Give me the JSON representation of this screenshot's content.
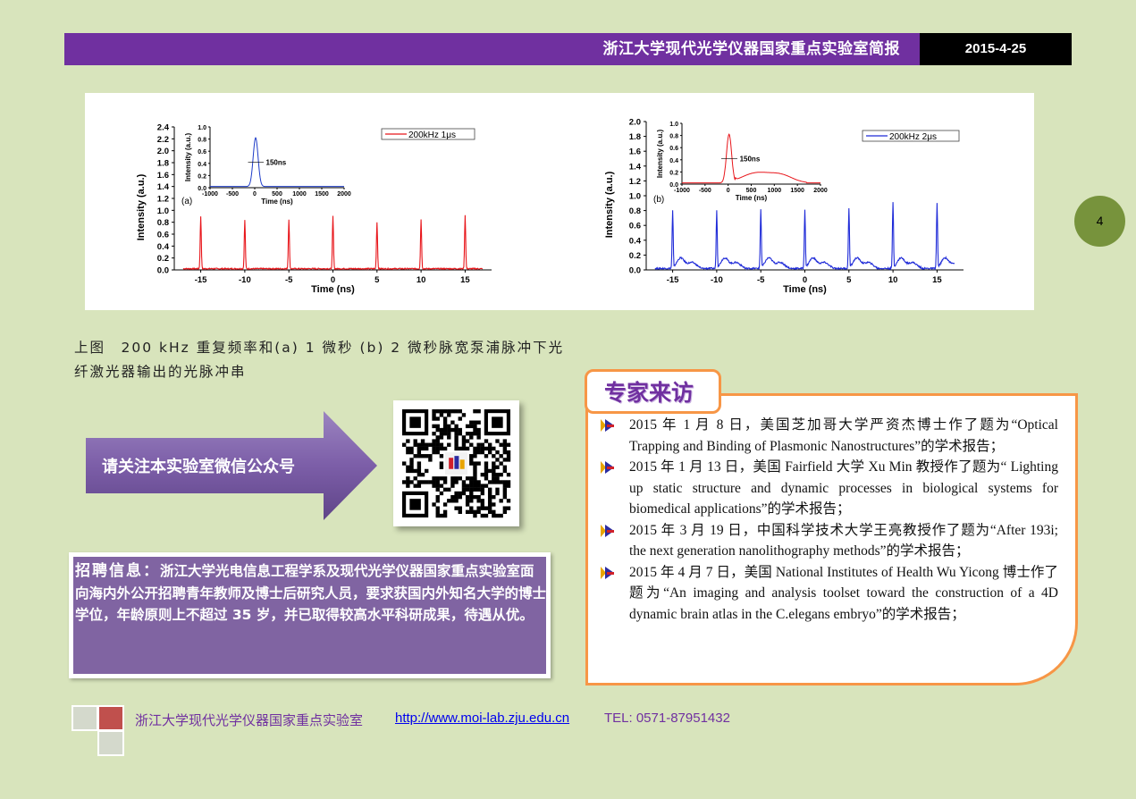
{
  "header": {
    "title": "浙江大学现代光学仪器国家重点实验室简报",
    "date": "2015-4-25"
  },
  "page_number": "4",
  "figure": {
    "chart_data": [
      {
        "type": "line",
        "panel": "(a)",
        "legend": "200kHz 1μs",
        "series_color": "#e8161b",
        "xlabel": "Time (ns)",
        "ylabel": "Intensity (a.u.)",
        "xlim": [
          -18,
          18
        ],
        "ylim": [
          0,
          2.4
        ],
        "x_ticks": [
          "-15",
          "-10",
          "-5",
          "0",
          "5",
          "10",
          "15"
        ],
        "y_ticks": [
          "0.0",
          "0.2",
          "0.4",
          "0.6",
          "0.8",
          "1.0",
          "1.2",
          "1.4",
          "1.6",
          "1.8",
          "2.0",
          "2.2",
          "2.4"
        ],
        "pulse_positions": [
          -15,
          -10,
          -5,
          0,
          5,
          10,
          15
        ],
        "pulse_peaks": [
          0.88,
          0.82,
          0.83,
          0.88,
          0.78,
          0.83,
          0.9
        ],
        "inset": {
          "xlabel": "Time (ns)",
          "ylabel": "Intensity (a.u.)",
          "x_ticks": [
            "-1000",
            "-500",
            "0",
            "500",
            "1000",
            "1500",
            "2000"
          ],
          "y_ticks": [
            "0.0",
            "0.2",
            "0.4",
            "0.6",
            "0.8",
            "1.0"
          ],
          "annotation": "150ns",
          "series_color": "#1f3cc8"
        }
      },
      {
        "type": "line",
        "panel": "(b)",
        "legend": "200kHz 2μs",
        "series_color": "#1f2bd8",
        "xlabel": "Time (ns)",
        "ylabel": "Intensity (a.u.)",
        "xlim": [
          -18,
          18
        ],
        "ylim": [
          0,
          2.0
        ],
        "x_ticks": [
          "-15",
          "-10",
          "-5",
          "0",
          "5",
          "10",
          "15"
        ],
        "y_ticks": [
          "0.0",
          "0.2",
          "0.4",
          "0.6",
          "0.8",
          "1.0",
          "1.2",
          "1.4",
          "1.6",
          "1.8",
          "2.0"
        ],
        "pulse_positions": [
          -15,
          -10,
          -5,
          0,
          5,
          10,
          15
        ],
        "pulse_peaks": [
          0.78,
          0.78,
          0.8,
          0.8,
          0.82,
          0.9,
          0.88
        ],
        "inset": {
          "xlabel": "Time (ns)",
          "ylabel": "Intensity (a.u.)",
          "x_ticks": [
            "-1000",
            "-500",
            "0",
            "500",
            "1000",
            "1500",
            "2000"
          ],
          "y_ticks": [
            "0.0",
            "0.2",
            "0.4",
            "0.6",
            "0.8",
            "1.0"
          ],
          "annotation": "150ns",
          "series_color": "#e8161b"
        }
      }
    ]
  },
  "caption": "上图　200 kHz 重复频率和(a) 1 微秒 (b) 2 微秒脉宽泵浦脉冲下光纤激光器输出的光脉冲串",
  "wechat": {
    "label": "请关注本实验室微信公众号",
    "qr_icon": "qr-code-icon"
  },
  "recruit": {
    "heading": "招聘信息：",
    "body": "浙江大学光电信息工程学系及现代光学仪器国家重点实验室面向海内外公开招聘青年教师及博士后研究人员，要求获国内外知名大学的博士学位，年龄原则上不超过 35 岁，并已取得较高水平科研成果，待遇从优。"
  },
  "experts": {
    "title": "专家来访",
    "items": [
      "2015 年 1 月 8 日，美国芝加哥大学严资杰博士作了题为“Optical Trapping and Binding of Plasmonic Nanostructures”的学术报告；",
      "2015 年 1 月 13 日，美国 Fairfield 大学 Xu Min 教授作了题为“ Lighting up static structure and dynamic processes in biological systems for biomedical applications”的学术报告；",
      "2015 年 3 月 19 日，中国科学技术大学王亮教授作了题为“After 193i; the next generation nanolithography methods”的学术报告；",
      "2015 年 4 月 7 日，美国 National Institutes of Health Wu Yicong 博士作了题为“An imaging and analysis toolset toward the construction of a 4D dynamic brain atlas in the C.elegans embryo”的学术报告；"
    ]
  },
  "footer": {
    "lab_name": "浙江大学现代光学仪器国家重点实验室",
    "url": "http://www.moi-lab.zju.edu.cn",
    "tel": "TEL: 0571-87951432"
  },
  "colors": {
    "page_bg": "#d8e4bc",
    "header_purple": "#7030a0",
    "accent_orange": "#f79646",
    "recruit_purple": "#8064a2",
    "page_circle": "#77933c"
  }
}
